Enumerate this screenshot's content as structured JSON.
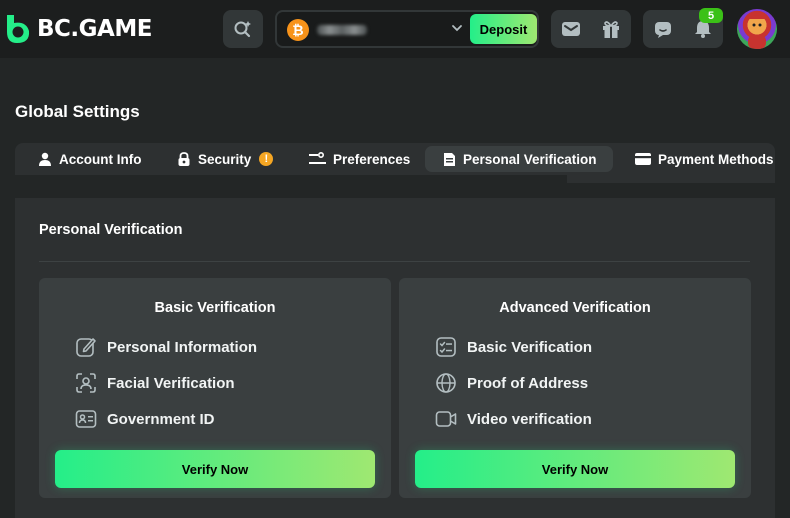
{
  "header": {
    "brand": "BC.GAME",
    "wallet": {
      "currency_symbol": "₿",
      "deposit_label": "Deposit"
    },
    "notifications_count": "5"
  },
  "page": {
    "title": "Global Settings",
    "tabs": [
      {
        "label": "Account Info",
        "icon": "user-icon"
      },
      {
        "label": "Security",
        "icon": "lock-icon",
        "alert": "!"
      },
      {
        "label": "Preferences",
        "icon": "sliders-icon"
      },
      {
        "label": "Personal Verification",
        "icon": "document-icon",
        "active": true
      },
      {
        "label": "Payment Methods",
        "icon": "card-icon"
      }
    ],
    "section_title": "Personal Verification",
    "cards": [
      {
        "title": "Basic Verification",
        "items": [
          "Personal Information",
          "Facial Verification",
          "Government ID"
        ],
        "button": "Verify Now"
      },
      {
        "title": "Advanced Verification",
        "items": [
          "Basic Verification",
          "Proof of Address",
          "Video verification"
        ],
        "button": "Verify Now"
      }
    ]
  },
  "colors": {
    "accent_start": "#24ee89",
    "accent_end": "#9fe871",
    "background": "#232626",
    "panel": "#2d3031",
    "card": "#3a3f40",
    "badge": "#3bc117",
    "warning": "#f5a623",
    "bitcoin": "#f7931a"
  }
}
